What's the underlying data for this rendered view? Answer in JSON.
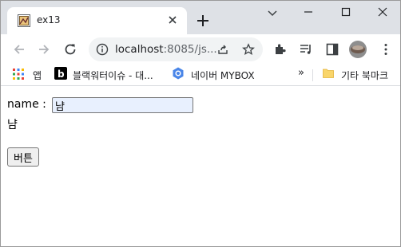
{
  "window": {
    "tab": {
      "title": "ex13",
      "favicon": "page-thumbnail-icon"
    },
    "controls": [
      "minimize-icon",
      "maximize-icon",
      "close-icon"
    ],
    "colors": {
      "tabstrip": "#dee1e6",
      "omnibox": "#f1f3f4"
    }
  },
  "toolbar": {
    "url_host": "localhost",
    "url_rest": ":8085/js..."
  },
  "bookmarks": {
    "items": [
      {
        "label": "앱",
        "icon": "apps-grid-icon"
      },
      {
        "label": "블랙워터이슈 - 대...",
        "icon": "b-logo-icon"
      },
      {
        "label": "네이버 MYBOX",
        "icon": "mybox-hex-icon"
      }
    ],
    "overflow": "»",
    "other": "기타 북마크"
  },
  "page": {
    "name_label": "name :",
    "name_value": "냠",
    "output_text": "냠",
    "button_label": "버튼"
  }
}
